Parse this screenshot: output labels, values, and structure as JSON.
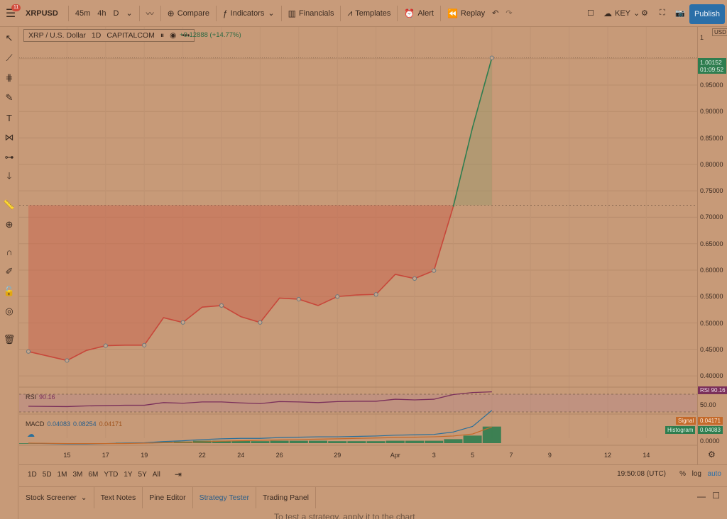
{
  "toolbar": {
    "badge": "11",
    "symbol": "XRPUSD",
    "intervals": [
      "45m",
      "4h",
      "D"
    ],
    "compare": "Compare",
    "indicators": "Indicators",
    "financials": "Financials",
    "templates": "Templates",
    "alert": "Alert",
    "replay": "Replay",
    "layout": "KEY",
    "publish": "Publish"
  },
  "legend": {
    "name": "XRP / U.S. Dollar",
    "interval": "1D",
    "exchange": "CAPITALCOM",
    "change": "+0.12888 (+14.77%)"
  },
  "price_scale": {
    "currency": "USD",
    "top_label": "1",
    "labels": [
      "0.95000",
      "0.90000",
      "0.85000",
      "0.80000",
      "0.75000",
      "0.70000",
      "0.65000",
      "0.60000",
      "0.55000",
      "0.50000",
      "0.45000",
      "0.40000"
    ],
    "last_price": "1.00152",
    "countdown": "01:09:52"
  },
  "rsi": {
    "label": "RSI",
    "value": "90.16",
    "tag_label": "RSI",
    "level_label": "50.00"
  },
  "macd": {
    "label": "MACD",
    "macd": "0.04083",
    "signal": "0.08254",
    "hist": "0.04171",
    "signal_tag": "Signal",
    "signal_tag_value": "0.04171",
    "hist_tag": "Histogram",
    "hist_tag_value": "0.04083",
    "zero_label": "0.0000"
  },
  "colors": {
    "down": "#c7473a",
    "up": "#2e7d4f",
    "rsi": "#7a2f5a",
    "macd": "#2a6f9a",
    "signal": "#c46a2a",
    "hist": "#2e7d4f"
  },
  "chart_data": {
    "type": "line",
    "x": [
      "Mar 13",
      "Mar 15",
      "Mar 16",
      "Mar 17",
      "Mar 18",
      "Mar 19",
      "Mar 20",
      "Mar 21",
      "Mar 22",
      "Mar 23",
      "Mar 24",
      "Mar 25",
      "Mar 26",
      "Mar 27",
      "Mar 28",
      "Mar 29",
      "Mar 30",
      "Mar 31",
      "Apr 1",
      "Apr 2",
      "Apr 3",
      "Apr 4",
      "Apr 5",
      "Apr 6"
    ],
    "values": [
      0.446,
      0.429,
      0.448,
      0.457,
      0.458,
      0.458,
      0.51,
      0.501,
      0.53,
      0.533,
      0.512,
      0.501,
      0.547,
      0.545,
      0.533,
      0.55,
      0.553,
      0.554,
      0.592,
      0.584,
      0.599,
      0.72,
      0.87,
      1.00152
    ],
    "ylim": [
      0.38,
      1.06
    ],
    "x_ticks": [
      "15",
      "17",
      "19",
      "22",
      "24",
      "26",
      "29",
      "Apr",
      "3",
      "5",
      "7",
      "9",
      "12",
      "14"
    ],
    "rsi": [
      47,
      46,
      48,
      49,
      50,
      50,
      58,
      56,
      60,
      60,
      57,
      55,
      61,
      60,
      58,
      61,
      62,
      62,
      68,
      66,
      68,
      82,
      88,
      90.16
    ],
    "macd": [
      0.0,
      -0.002,
      -0.002,
      -0.001,
      0.0,
      0.001,
      0.004,
      0.006,
      0.009,
      0.011,
      0.012,
      0.012,
      0.014,
      0.015,
      0.016,
      0.016,
      0.017,
      0.018,
      0.02,
      0.021,
      0.022,
      0.028,
      0.042,
      0.0825
    ],
    "signal": [
      0.0,
      -0.001,
      -0.001,
      -0.001,
      -0.001,
      0.0,
      0.001,
      0.002,
      0.003,
      0.005,
      0.006,
      0.007,
      0.008,
      0.009,
      0.01,
      0.011,
      0.012,
      0.013,
      0.014,
      0.015,
      0.016,
      0.018,
      0.023,
      0.0408
    ],
    "histogram": [
      0.0,
      -0.001,
      -0.001,
      0.0,
      0.001,
      0.001,
      0.003,
      0.004,
      0.006,
      0.006,
      0.006,
      0.005,
      0.006,
      0.006,
      0.006,
      0.005,
      0.005,
      0.005,
      0.006,
      0.006,
      0.006,
      0.01,
      0.019,
      0.0417
    ]
  },
  "ranges": [
    "1D",
    "5D",
    "1M",
    "3M",
    "6M",
    "YTD",
    "1Y",
    "5Y",
    "All"
  ],
  "clock": "19:50:08 (UTC)",
  "scale_opts": {
    "pct": "%",
    "log": "log",
    "auto": "auto"
  },
  "panel_tabs": [
    "Stock Screener",
    "Text Notes",
    "Pine Editor",
    "Strategy Tester",
    "Trading Panel"
  ],
  "panel_message": "To test a strategy, apply it to the chart"
}
